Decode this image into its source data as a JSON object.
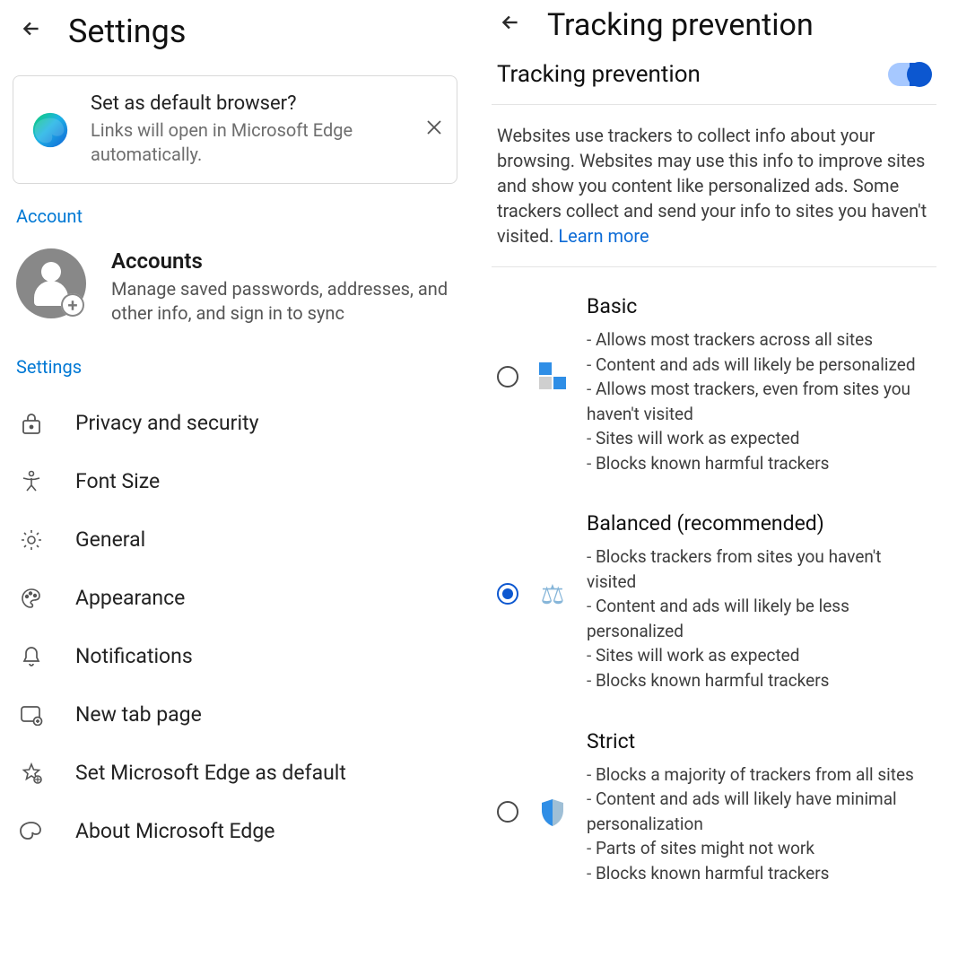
{
  "left": {
    "title": "Settings",
    "default_card": {
      "title": "Set as default browser?",
      "subtitle": "Links will open in Microsoft Edge automatically."
    },
    "section_account": "Account",
    "accounts": {
      "title": "Accounts",
      "desc": "Manage saved passwords, addresses, and other info, and sign in to sync"
    },
    "section_settings": "Settings",
    "items": {
      "privacy": "Privacy and security",
      "font": "Font Size",
      "general": "General",
      "appearance": "Appearance",
      "notifications": "Notifications",
      "newtab": "New tab page",
      "default_edge": "Set Microsoft Edge as default",
      "about": "About Microsoft Edge"
    }
  },
  "right": {
    "title": "Tracking prevention",
    "toggle_label": "Tracking prevention",
    "toggle_on": true,
    "description": "Websites use trackers to collect info about your browsing. Websites may use this info to improve sites and show you content like personalized ads. Some trackers collect and send your info to sites you haven't visited. ",
    "learn_more": "Learn more",
    "options": {
      "basic": {
        "title": "Basic",
        "bullets": [
          "Allows most trackers across all sites",
          "Content and ads will likely be personalized",
          "Allows most trackers, even from sites you haven't visited",
          "Sites will work as expected",
          "Blocks known harmful trackers"
        ],
        "selected": false
      },
      "balanced": {
        "title": "Balanced (recommended)",
        "bullets": [
          "Blocks trackers from sites you haven't visited",
          "Content and ads will likely be less personalized",
          "Sites will work as expected",
          "Blocks known harmful trackers"
        ],
        "selected": true
      },
      "strict": {
        "title": "Strict",
        "bullets": [
          "Blocks a majority of trackers from all sites",
          "Content and ads will likely have minimal personalization",
          "Parts of sites might not work",
          "Blocks known harmful trackers"
        ],
        "selected": false
      }
    }
  }
}
